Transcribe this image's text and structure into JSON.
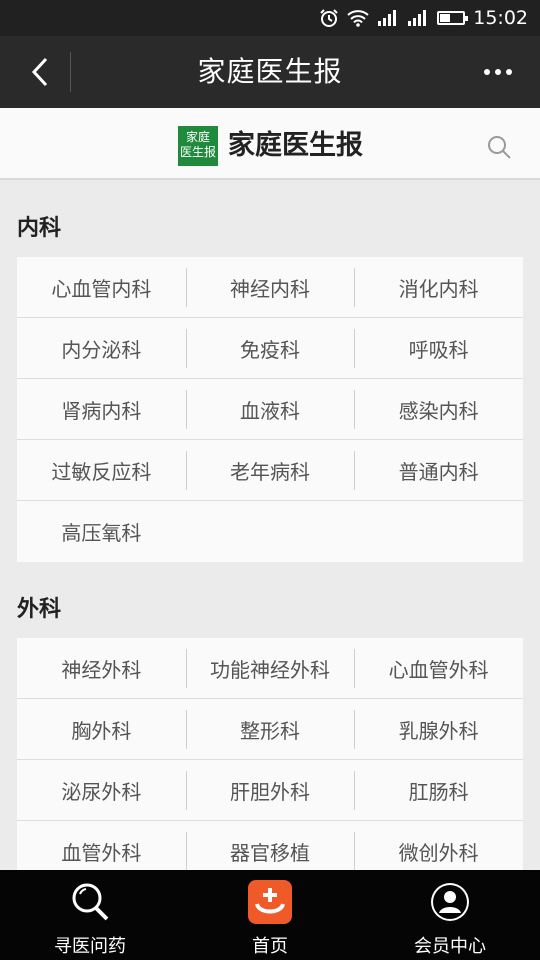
{
  "status_bar": {
    "time": "15:02",
    "battery_level": 0.45
  },
  "nav": {
    "title": "家庭医生报"
  },
  "brand": {
    "logo_text_line1": "家庭",
    "logo_text_line2": "医生报",
    "name": "家庭医生报"
  },
  "sections": [
    {
      "title": "内科",
      "items": [
        [
          "心血管内科",
          "神经内科",
          "消化内科"
        ],
        [
          "内分泌科",
          "免疫科",
          "呼吸科"
        ],
        [
          "肾病内科",
          "血液科",
          "感染内科"
        ],
        [
          "过敏反应科",
          "老年病科",
          "普通内科"
        ],
        [
          "高压氧科",
          "",
          ""
        ]
      ]
    },
    {
      "title": "外科",
      "items": [
        [
          "神经外科",
          "功能神经外科",
          "心血管外科"
        ],
        [
          "胸外科",
          "整形科",
          "乳腺外科"
        ],
        [
          "泌尿外科",
          "肝胆外科",
          "肛肠科"
        ],
        [
          "血管外科",
          "器官移植",
          "微创外科"
        ]
      ]
    }
  ],
  "tabbar": {
    "items": [
      {
        "label": "寻医问药",
        "icon": "search-icon"
      },
      {
        "label": "首页",
        "icon": "home-icon",
        "accent": "#f05a28"
      },
      {
        "label": "会员中心",
        "icon": "user-icon"
      }
    ]
  }
}
